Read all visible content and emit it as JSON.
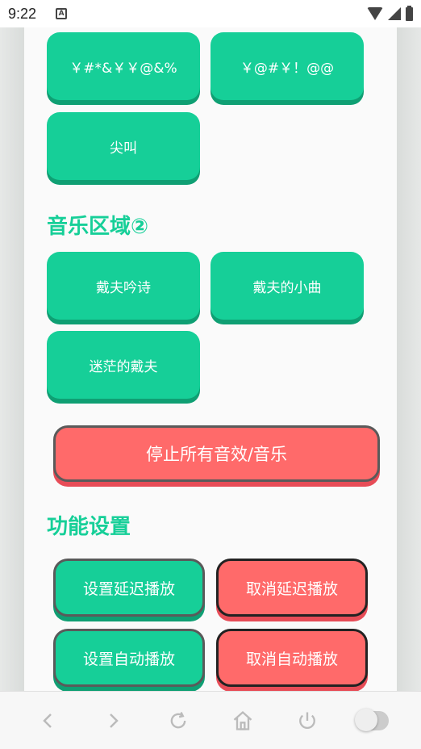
{
  "status": {
    "time": "9:22",
    "notif_glyph": "A"
  },
  "sections": {
    "music_area_2": "音乐区域②",
    "settings": "功能设置"
  },
  "top_buttons": [
    {
      "label": "￥#*&￥￥@&%"
    },
    {
      "label": "￥@#￥！@@"
    },
    {
      "label": "尖叫"
    }
  ],
  "music_buttons": [
    {
      "label": "戴夫吟诗"
    },
    {
      "label": "戴夫的小曲"
    },
    {
      "label": "迷茫的戴夫"
    }
  ],
  "stop_button": {
    "label": "停止所有音效/音乐"
  },
  "settings_buttons": [
    {
      "label": "设置延迟播放"
    },
    {
      "label": "取消延迟播放"
    },
    {
      "label": "设置自动播放"
    },
    {
      "label": "取消自动播放"
    }
  ],
  "colors": {
    "accent": "#16cf98",
    "danger": "#ff6a6a"
  }
}
